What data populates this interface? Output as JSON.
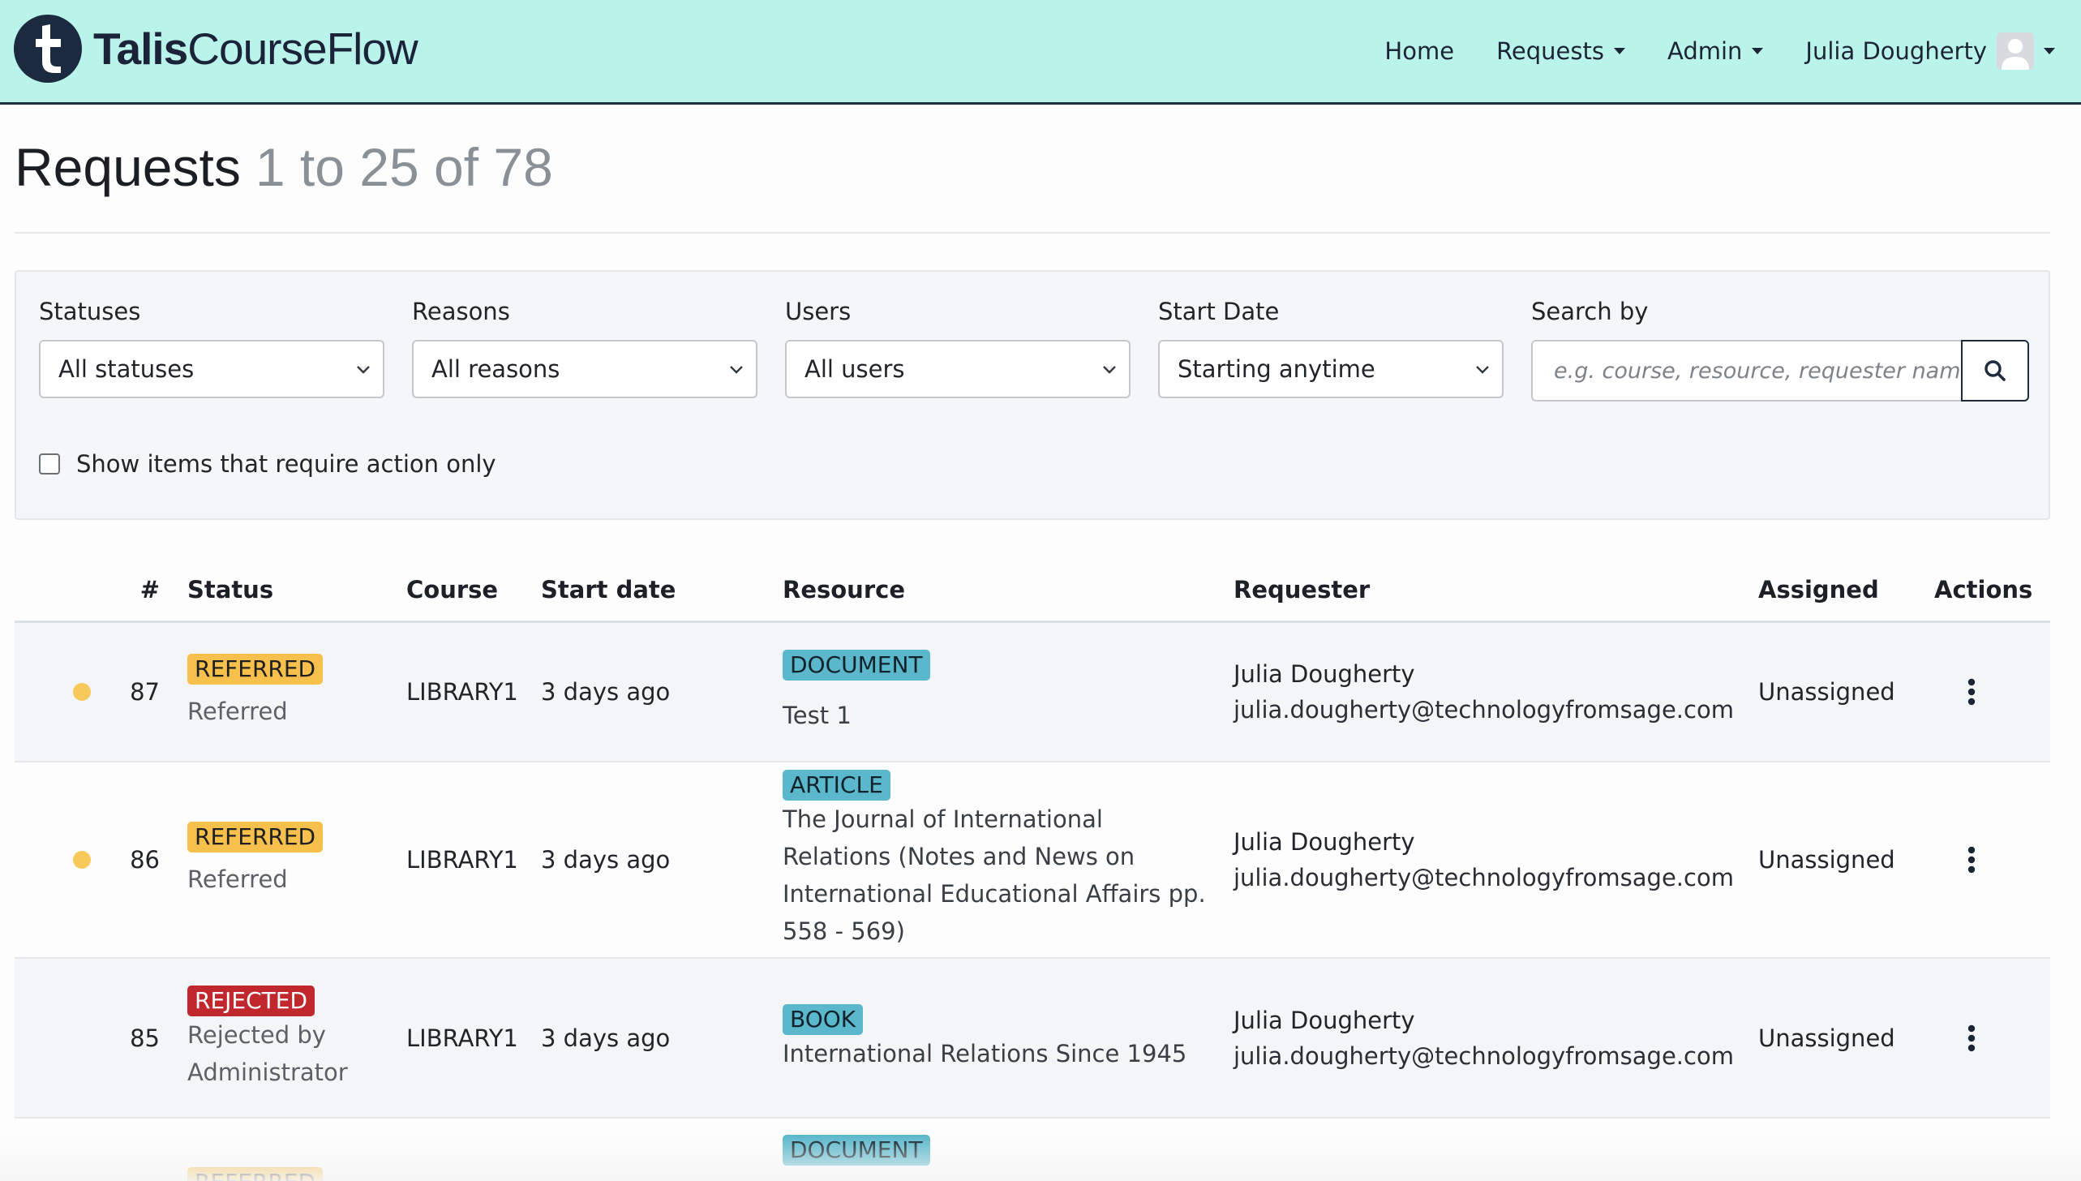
{
  "brand": {
    "name_bold": "Talis",
    "name_rest": "CourseFlow"
  },
  "nav": {
    "home": "Home",
    "requests": "Requests",
    "admin": "Admin",
    "user": "Julia Dougherty"
  },
  "page": {
    "title": "Requests",
    "range": "1 to 25 of 78"
  },
  "filters": {
    "statuses": {
      "label": "Statuses",
      "value": "All statuses"
    },
    "reasons": {
      "label": "Reasons",
      "value": "All reasons"
    },
    "users": {
      "label": "Users",
      "value": "All users"
    },
    "start_date": {
      "label": "Start Date",
      "value": "Starting anytime"
    },
    "search": {
      "label": "Search by",
      "placeholder": "e.g. course, resource, requester name"
    },
    "action_only": {
      "label": "Show items that require action only",
      "checked": false
    }
  },
  "table": {
    "headers": [
      "#",
      "Status",
      "Course",
      "Start date",
      "Resource",
      "Requester",
      "Assigned",
      "Actions"
    ],
    "rows": [
      {
        "num": "87",
        "flag": true,
        "badge": "REFERRED",
        "status": "Referred",
        "course": "LIBRARY1",
        "start": "3 days ago",
        "type": "DOCUMENT",
        "resource": "Test 1",
        "requester": "Julia Dougherty",
        "email": "julia.dougherty@technologyfromsage.com",
        "assigned": "Unassigned"
      },
      {
        "num": "86",
        "flag": true,
        "badge": "REFERRED",
        "status": "Referred",
        "course": "LIBRARY1",
        "start": "3 days ago",
        "type": "ARTICLE",
        "resource": "The Journal of International Relations (Notes and News on International Educational Affairs pp. 558 - 569)",
        "requester": "Julia Dougherty",
        "email": "julia.dougherty@technologyfromsage.com",
        "assigned": "Unassigned"
      },
      {
        "num": "85",
        "flag": false,
        "badge": "REJECTED",
        "status": "Rejected by Administrator",
        "course": "LIBRARY1",
        "start": "3 days ago",
        "type": "BOOK",
        "resource": "International Relations Since 1945",
        "requester": "Julia Dougherty",
        "email": "julia.dougherty@technologyfromsage.com",
        "assigned": "Unassigned"
      },
      {
        "num": "",
        "flag": false,
        "badge": "REFERRED",
        "status": "",
        "course": "",
        "start": "",
        "type": "DOCUMENT",
        "resource": "",
        "requester": "",
        "email": "",
        "assigned": ""
      }
    ]
  },
  "colors": {
    "navbar": "#b9f3ea",
    "referred_badge": "#f7c04c",
    "rejected_badge": "#c0282d",
    "type_badge": "#5bb7cc",
    "flag_dot": "#f6c95a"
  }
}
